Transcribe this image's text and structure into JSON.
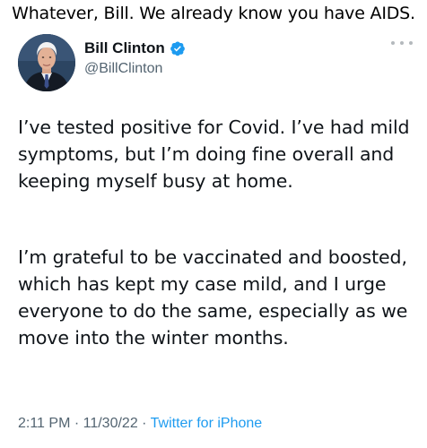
{
  "caption": "Whatever, Bill. We already know you have AIDS.",
  "tweet": {
    "display_name": "Bill Clinton",
    "handle": "@BillClinton",
    "verified_icon": "verified-badge-icon",
    "more_icon": "more-options-icon",
    "paragraphs": [
      "I’ve tested positive for Covid. I’ve had mild symptoms, but I’m doing fine overall and keeping myself busy at home.",
      "I’m grateful to be vaccinated and boosted, which has kept my case mild, and I urge everyone to do the same, especially as we move into the winter months."
    ],
    "time": "2:11 PM",
    "separator": " · ",
    "date": "11/30/22",
    "source": "Twitter for iPhone"
  },
  "colors": {
    "text": "#0f1419",
    "muted": "#536471",
    "link": "#1d9bf0",
    "verified": "#1d9bf0"
  }
}
